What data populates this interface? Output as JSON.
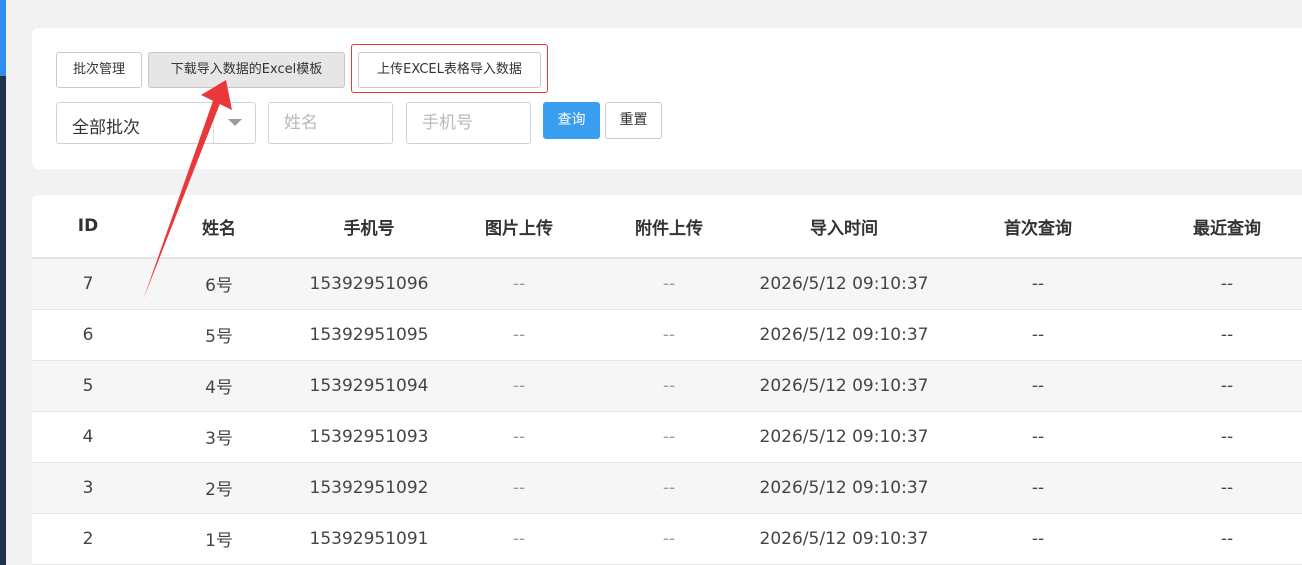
{
  "toolbar": {
    "batch_label": "批次管理",
    "download_label": "下载导入数据的Excel模板",
    "upload_label": "上传EXCEL表格导入数据"
  },
  "filters": {
    "batch_select_value": "全部批次",
    "name_placeholder": "姓名",
    "phone_placeholder": "手机号",
    "query_label": "查询",
    "reset_label": "重置"
  },
  "table": {
    "columns": [
      "ID",
      "姓名",
      "手机号",
      "图片上传",
      "附件上传",
      "导入时间",
      "首次查询",
      "最近查询"
    ],
    "rows": [
      {
        "id": "7",
        "name": "6号",
        "phone": "15392951096",
        "image": "--",
        "attachment": "--",
        "import_time": "2026/5/12 09:10:37",
        "first_query": "--",
        "last_query": "--"
      },
      {
        "id": "6",
        "name": "5号",
        "phone": "15392951095",
        "image": "--",
        "attachment": "--",
        "import_time": "2026/5/12 09:10:37",
        "first_query": "--",
        "last_query": "--"
      },
      {
        "id": "5",
        "name": "4号",
        "phone": "15392951094",
        "image": "--",
        "attachment": "--",
        "import_time": "2026/5/12 09:10:37",
        "first_query": "--",
        "last_query": "--"
      },
      {
        "id": "4",
        "name": "3号",
        "phone": "15392951093",
        "image": "--",
        "attachment": "--",
        "import_time": "2026/5/12 09:10:37",
        "first_query": "--",
        "last_query": "--"
      },
      {
        "id": "3",
        "name": "2号",
        "phone": "15392951092",
        "image": "--",
        "attachment": "--",
        "import_time": "2026/5/12 09:10:37",
        "first_query": "--",
        "last_query": "--"
      },
      {
        "id": "2",
        "name": "1号",
        "phone": "15392951091",
        "image": "--",
        "attachment": "--",
        "import_time": "2026/5/12 09:10:37",
        "first_query": "--",
        "last_query": "--"
      }
    ]
  },
  "colors": {
    "primary": "#3a9ef0",
    "highlight_outline": "#e0393a",
    "annotation_arrow": "#e8383a",
    "sidebar": "#22304a",
    "sidebar_accent": "#2e8ded"
  },
  "icons": {
    "select_caret": "caret-down-icon",
    "annotation": "arrow-annotation-icon"
  }
}
